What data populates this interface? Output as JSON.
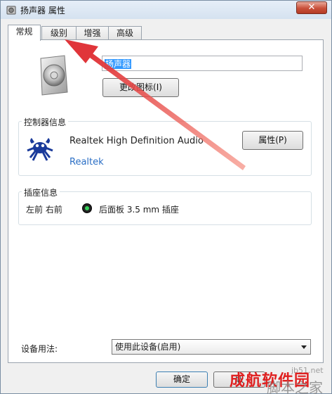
{
  "window": {
    "title": "扬声器 属性",
    "close_glyph": "✕"
  },
  "tabs": [
    {
      "label": "常规"
    },
    {
      "label": "级别"
    },
    {
      "label": "增强"
    },
    {
      "label": "高级"
    }
  ],
  "general": {
    "device_name_value": "扬声器",
    "change_icon_label": "更改图标(I)",
    "controller": {
      "title": "控制器信息",
      "device": "Realtek High Definition Audio",
      "vendor": "Realtek",
      "properties_label": "属性(P)"
    },
    "jack": {
      "title": "插座信息",
      "location": "左前 右前",
      "description": "后面板 3.5 mm 插座"
    },
    "usage": {
      "label": "设备用法:",
      "selected": "使用此设备(启用)"
    }
  },
  "footer": {
    "ok_label": "确定",
    "cancel_label": "取"
  },
  "watermark": {
    "brand": "成航软件园",
    "site": "脚本之家",
    "url": "jb51.net"
  },
  "colors": {
    "arrow": "#e0353a",
    "jack_indicator": "#35d25a",
    "selection": "#3399ff"
  }
}
